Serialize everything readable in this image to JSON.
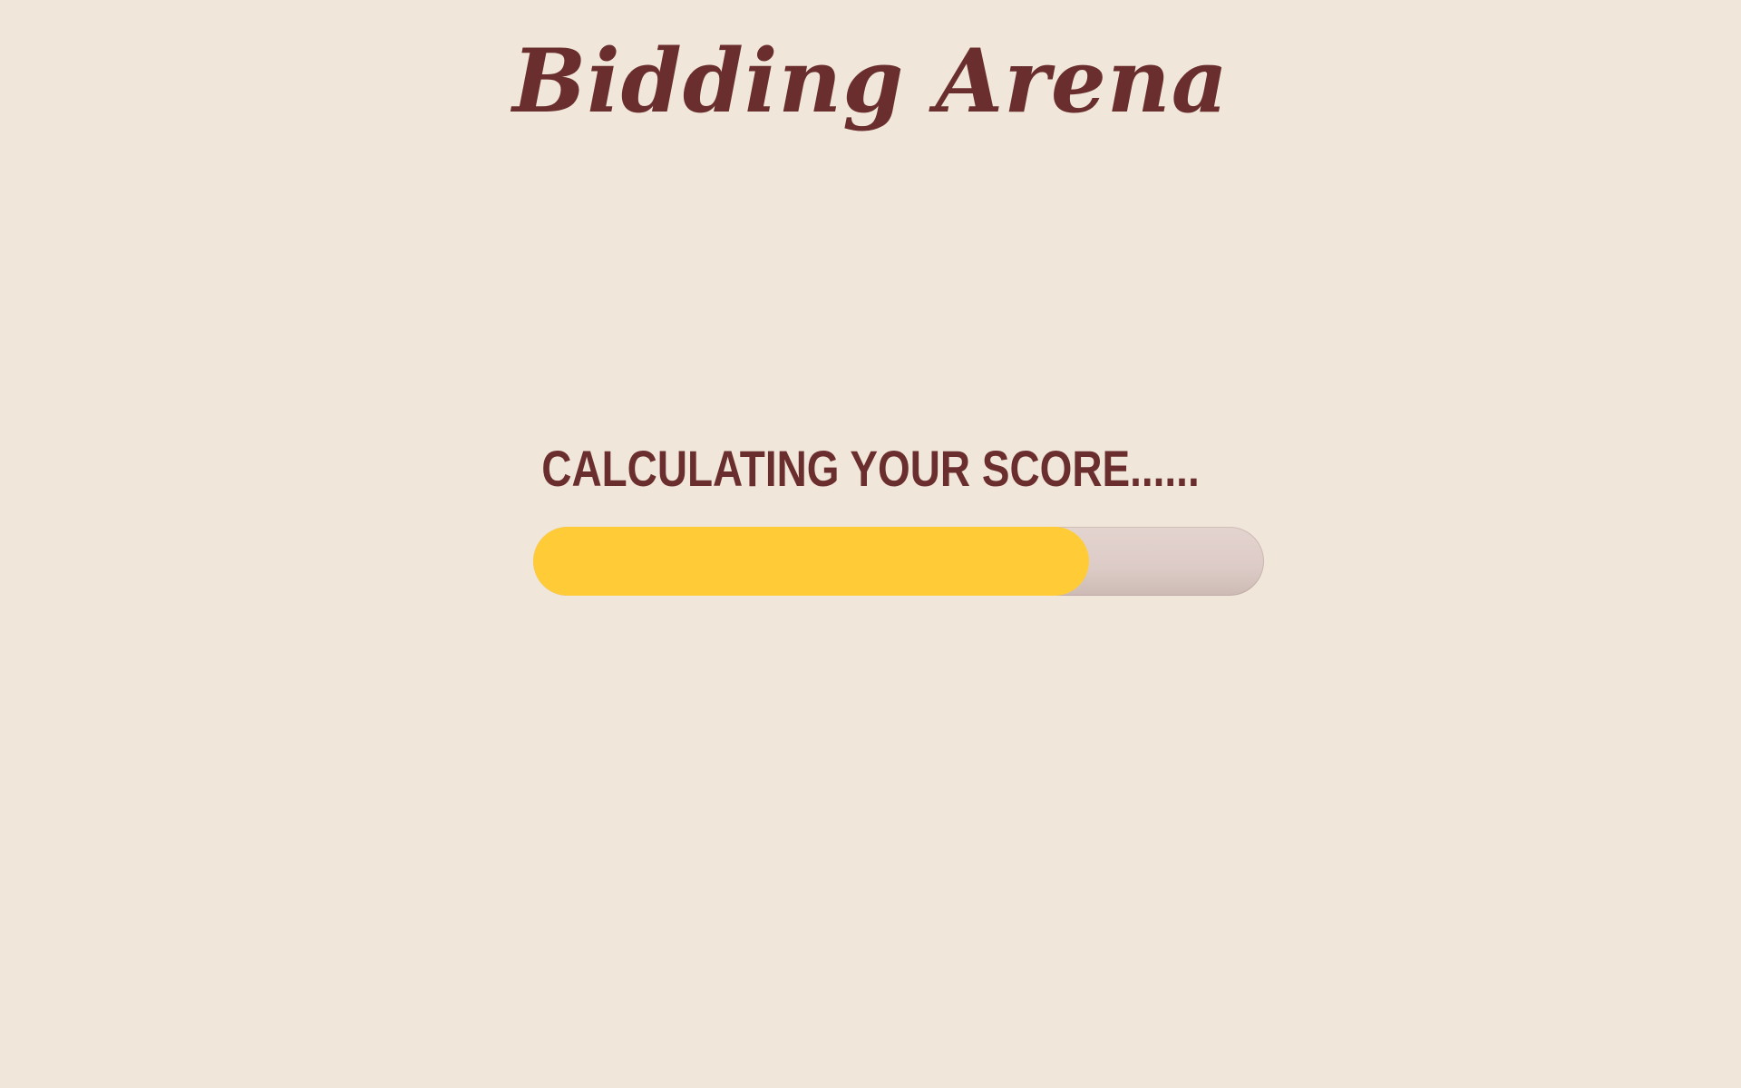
{
  "app": {
    "title": "Bidding Arena"
  },
  "loading": {
    "status_text": "Calculating your score......",
    "progress_percent": 76
  },
  "colors": {
    "background": "#F0E6D9",
    "text": "#6B2E2E",
    "progress_fill": "#FFCC38",
    "progress_track": "#DCCBC6"
  }
}
